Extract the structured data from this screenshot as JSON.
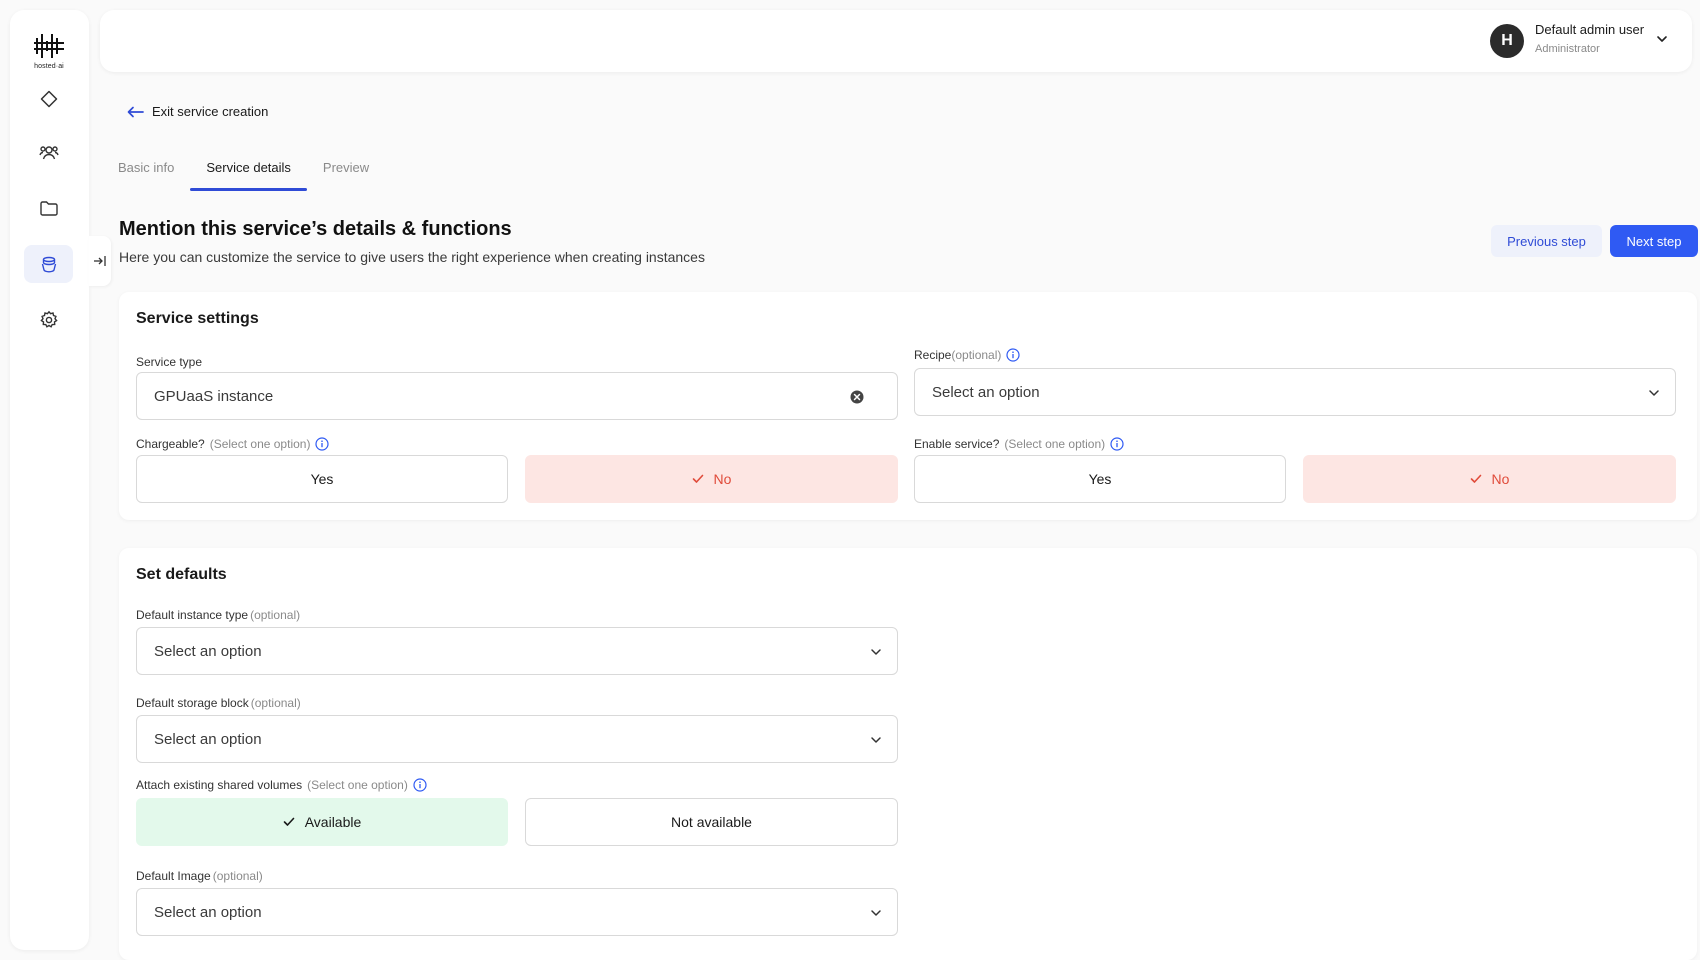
{
  "brand": {
    "logo_text": "hosted·ai"
  },
  "user": {
    "initial": "H",
    "name": "Default admin user",
    "role": "Administrator"
  },
  "nav": {
    "back_label": "Exit service creation",
    "tabs": [
      {
        "label": "Basic info",
        "active": false
      },
      {
        "label": "Service details",
        "active": true
      },
      {
        "label": "Preview",
        "active": false
      }
    ]
  },
  "page": {
    "title": "Mention this service’s details & functions",
    "subtitle": "Here you can customize the service to give users the right experience when creating instances",
    "prev_label": "Previous step",
    "next_label": "Next step"
  },
  "service_settings": {
    "title": "Service settings",
    "service_type": {
      "label": "Service type",
      "value": "GPUaaS instance"
    },
    "recipe": {
      "label": "Recipe",
      "optional": "(optional)",
      "placeholder": "Select an option"
    },
    "chargeable": {
      "label": "Chargeable?",
      "hint": "(Select one option)",
      "options": [
        "Yes",
        "No"
      ],
      "selected": "No"
    },
    "enable_service": {
      "label": "Enable service?",
      "hint": "(Select one option)",
      "options": [
        "Yes",
        "No"
      ],
      "selected": "No"
    }
  },
  "set_defaults": {
    "title": "Set defaults",
    "instance_type": {
      "label": "Default instance type",
      "optional": "(optional)",
      "placeholder": "Select an option"
    },
    "storage_block": {
      "label": "Default storage block",
      "optional": "(optional)",
      "placeholder": "Select an option"
    },
    "shared_volumes": {
      "label": "Attach existing shared volumes",
      "hint": "(Select one option)",
      "options": [
        "Available",
        "Not available"
      ],
      "selected": "Available"
    },
    "image": {
      "label": "Default Image",
      "optional": "(optional)",
      "placeholder": "Select an option"
    }
  },
  "colors": {
    "accent": "#2f5af3",
    "selected_red_bg": "#fde6e3",
    "selected_red_text": "#e04b3a",
    "selected_green_bg": "#e3f9eb"
  },
  "icons": {
    "nav": [
      "diamond-icon",
      "users-icon",
      "folder-icon",
      "services-icon",
      "settings-icon"
    ]
  }
}
